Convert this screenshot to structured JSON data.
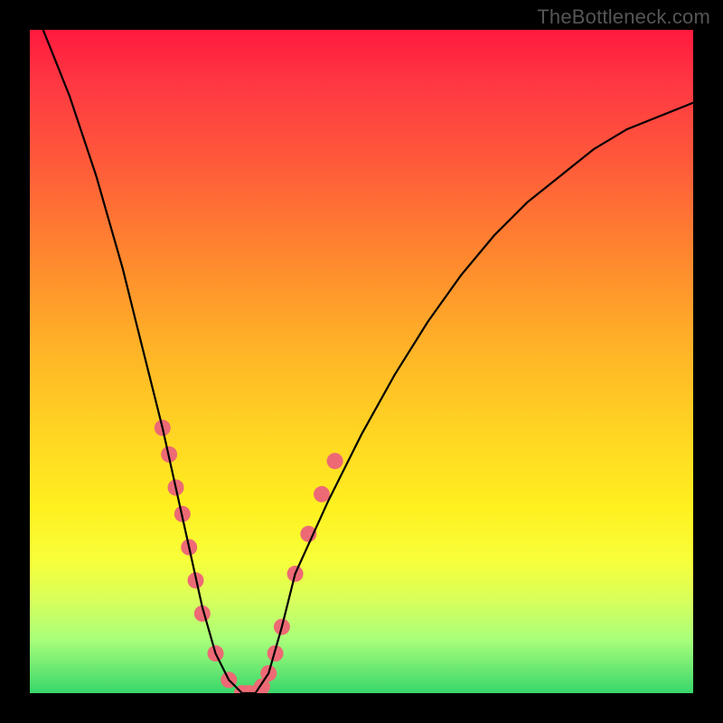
{
  "watermark": "TheBottleneck.com",
  "colors": {
    "frame": "#000000",
    "curve": "#000000",
    "marker": "#ed6a75",
    "gradient_stops": [
      "#ff1a3d",
      "#ff3743",
      "#ff5a3a",
      "#ff8a2e",
      "#ffb327",
      "#ffd323",
      "#fff020",
      "#f7ff3a",
      "#d8ff5c",
      "#a8ff7a",
      "#38d66b"
    ]
  },
  "chart_data": {
    "type": "line",
    "title": "",
    "xlabel": "",
    "ylabel": "",
    "xlim": [
      0,
      100
    ],
    "ylim": [
      0,
      100
    ],
    "x": [
      2,
      4,
      6,
      8,
      10,
      12,
      14,
      16,
      18,
      20,
      22,
      24,
      26,
      28,
      30,
      32,
      34,
      36,
      38,
      40,
      45,
      50,
      55,
      60,
      65,
      70,
      75,
      80,
      85,
      90,
      95,
      100
    ],
    "series": [
      {
        "name": "curve",
        "values": [
          100,
          95,
          90,
          84,
          78,
          71,
          64,
          56,
          48,
          40,
          31,
          22,
          13,
          6,
          2,
          0,
          0,
          3,
          10,
          18,
          29,
          39,
          48,
          56,
          63,
          69,
          74,
          78,
          82,
          85,
          87,
          89
        ]
      }
    ],
    "markers": [
      {
        "x": 20,
        "y": 40
      },
      {
        "x": 21,
        "y": 36
      },
      {
        "x": 22,
        "y": 31
      },
      {
        "x": 23,
        "y": 27
      },
      {
        "x": 24,
        "y": 22
      },
      {
        "x": 25,
        "y": 17
      },
      {
        "x": 26,
        "y": 12
      },
      {
        "x": 28,
        "y": 6
      },
      {
        "x": 30,
        "y": 2
      },
      {
        "x": 32,
        "y": 0
      },
      {
        "x": 33,
        "y": 0
      },
      {
        "x": 34,
        "y": 0
      },
      {
        "x": 35,
        "y": 1
      },
      {
        "x": 36,
        "y": 3
      },
      {
        "x": 37,
        "y": 6
      },
      {
        "x": 38,
        "y": 10
      },
      {
        "x": 40,
        "y": 18
      },
      {
        "x": 42,
        "y": 24
      },
      {
        "x": 44,
        "y": 30
      },
      {
        "x": 46,
        "y": 35
      }
    ],
    "marker_radius_px": 9
  }
}
